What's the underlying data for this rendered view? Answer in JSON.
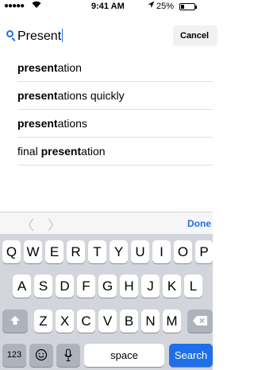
{
  "status_bar": {
    "signal": "●●●●●",
    "time": "9:41 AM",
    "battery": "25%",
    "battery_level": 0.25
  },
  "search": {
    "query": "Present",
    "cancel_label": "Cancel"
  },
  "suggestions": [
    {
      "bold": "present",
      "rest": "ation",
      "prefix": ""
    },
    {
      "bold": "present",
      "rest": "ations quickly",
      "prefix": ""
    },
    {
      "bold": "present",
      "rest": "ations",
      "prefix": ""
    },
    {
      "bold": "present",
      "rest": "ation",
      "prefix": "final "
    }
  ],
  "accessory": {
    "prev": "〈",
    "next": "〉",
    "done_label": "Done"
  },
  "keyboard": {
    "row1": [
      "Q",
      "W",
      "E",
      "R",
      "T",
      "Y",
      "U",
      "I",
      "O",
      "P"
    ],
    "row2": [
      "A",
      "S",
      "D",
      "F",
      "G",
      "H",
      "J",
      "K",
      "L"
    ],
    "row3": [
      "Z",
      "X",
      "C",
      "V",
      "B",
      "N",
      "M"
    ],
    "numbers_label": "123",
    "space_label": "space",
    "search_label": "Search",
    "shift_icon": "shift-icon",
    "delete_icon": "delete-icon",
    "emoji_icon": "emoji-icon",
    "mic_icon": "microphone-icon"
  },
  "colors": {
    "accent": "#1e6fe8"
  }
}
